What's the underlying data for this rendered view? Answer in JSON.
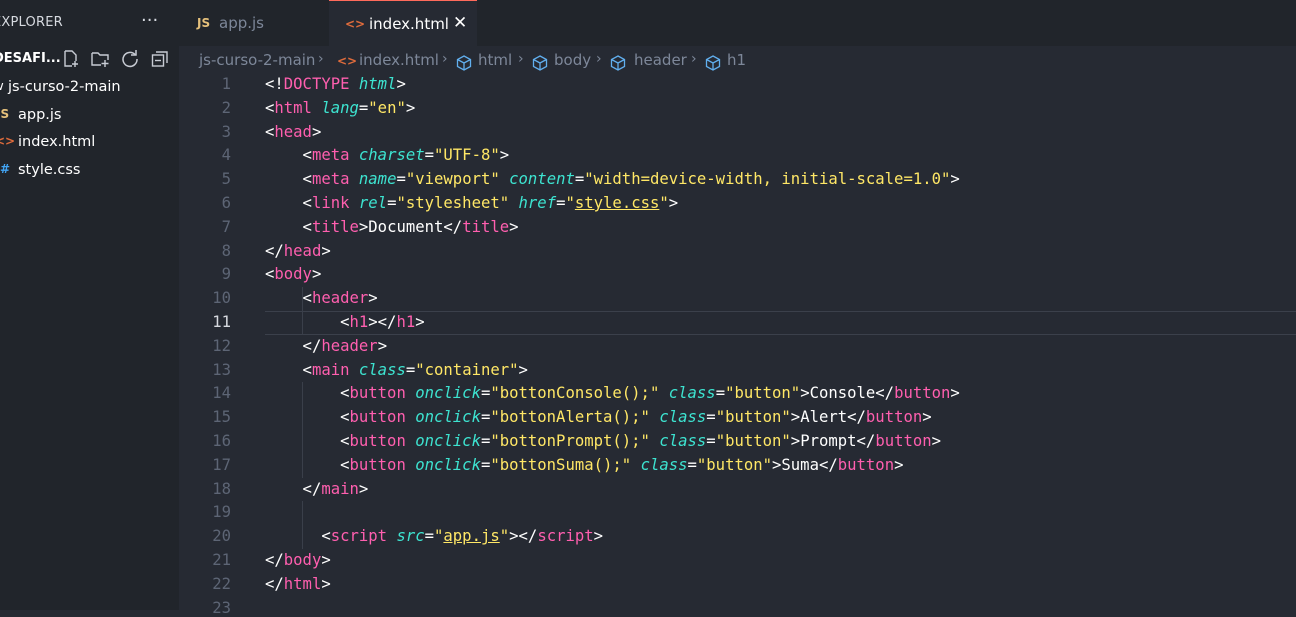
{
  "explorer": {
    "title": "EXPLORER",
    "more": "···",
    "project": "DESAFI...",
    "tree": [
      {
        "label": "js-curso-2-main",
        "icon": "chevron-down-icon",
        "glyph": "∨"
      },
      {
        "label": "app.js",
        "icon": "js-file-icon",
        "glyph": "JS"
      },
      {
        "label": "index.html",
        "icon": "html-file-icon",
        "glyph": "<>"
      },
      {
        "label": "style.css",
        "icon": "css-file-icon",
        "glyph": "#"
      }
    ]
  },
  "tabs": [
    {
      "label": "app.js",
      "icon": "JS",
      "active": false
    },
    {
      "label": "index.html",
      "icon": "<>",
      "active": true,
      "close": "✕"
    }
  ],
  "breadcrumb": [
    "js-curso-2-main",
    "index.html",
    "html",
    "body",
    "header",
    "h1"
  ],
  "editor": {
    "current_line": 11,
    "lines": [
      {
        "n": "1",
        "tokens": [
          [
            "p",
            "<!"
          ],
          [
            "t",
            "DOCTYPE"
          ],
          [
            "p",
            " "
          ],
          [
            "a",
            "html"
          ],
          [
            "p",
            ">"
          ]
        ]
      },
      {
        "n": "2",
        "tokens": [
          [
            "p",
            "<"
          ],
          [
            "t",
            "html"
          ],
          [
            "p",
            " "
          ],
          [
            "a",
            "lang"
          ],
          [
            "p",
            "="
          ],
          [
            "s",
            "\"en\""
          ],
          [
            "p",
            ">"
          ]
        ]
      },
      {
        "n": "3",
        "tokens": [
          [
            "p",
            "<"
          ],
          [
            "t",
            "head"
          ],
          [
            "p",
            ">"
          ]
        ]
      },
      {
        "n": "4",
        "tokens": [
          [
            "p",
            "    <"
          ],
          [
            "t",
            "meta"
          ],
          [
            "p",
            " "
          ],
          [
            "a",
            "charset"
          ],
          [
            "p",
            "="
          ],
          [
            "s",
            "\"UTF-8\""
          ],
          [
            "p",
            ">"
          ]
        ]
      },
      {
        "n": "5",
        "tokens": [
          [
            "p",
            "    <"
          ],
          [
            "t",
            "meta"
          ],
          [
            "p",
            " "
          ],
          [
            "a",
            "name"
          ],
          [
            "p",
            "="
          ],
          [
            "s",
            "\"viewport\""
          ],
          [
            "p",
            " "
          ],
          [
            "a",
            "content"
          ],
          [
            "p",
            "="
          ],
          [
            "s",
            "\"width=device-width, initial-scale=1.0\""
          ],
          [
            "p",
            ">"
          ]
        ]
      },
      {
        "n": "6",
        "tokens": [
          [
            "p",
            "    <"
          ],
          [
            "t",
            "link"
          ],
          [
            "p",
            " "
          ],
          [
            "a",
            "rel"
          ],
          [
            "p",
            "="
          ],
          [
            "s",
            "\"stylesheet\""
          ],
          [
            "p",
            " "
          ],
          [
            "a",
            "href"
          ],
          [
            "p",
            "="
          ],
          [
            "s",
            "\""
          ],
          [
            "l",
            "style.css"
          ],
          [
            "s",
            "\""
          ],
          [
            "p",
            ">"
          ]
        ]
      },
      {
        "n": "7",
        "tokens": [
          [
            "p",
            "    <"
          ],
          [
            "t",
            "title"
          ],
          [
            "p",
            ">"
          ],
          [
            "x",
            "Document"
          ],
          [
            "p",
            "</"
          ],
          [
            "t",
            "title"
          ],
          [
            "p",
            ">"
          ]
        ]
      },
      {
        "n": "8",
        "tokens": [
          [
            "p",
            "</"
          ],
          [
            "t",
            "head"
          ],
          [
            "p",
            ">"
          ]
        ]
      },
      {
        "n": "9",
        "tokens": [
          [
            "p",
            "<"
          ],
          [
            "t",
            "body"
          ],
          [
            "p",
            ">"
          ]
        ]
      },
      {
        "n": "10",
        "tokens": [
          [
            "p",
            "    <"
          ],
          [
            "t",
            "header"
          ],
          [
            "p",
            ">"
          ]
        ]
      },
      {
        "n": "11",
        "tokens": [
          [
            "p",
            "        <"
          ],
          [
            "t",
            "h1"
          ],
          [
            "p",
            "></"
          ],
          [
            "t",
            "h1"
          ],
          [
            "p",
            ">"
          ]
        ]
      },
      {
        "n": "12",
        "tokens": [
          [
            "p",
            "    </"
          ],
          [
            "t",
            "header"
          ],
          [
            "p",
            ">"
          ]
        ]
      },
      {
        "n": "13",
        "tokens": [
          [
            "p",
            "    <"
          ],
          [
            "t",
            "main"
          ],
          [
            "p",
            " "
          ],
          [
            "a",
            "class"
          ],
          [
            "p",
            "="
          ],
          [
            "s",
            "\"container\""
          ],
          [
            "p",
            ">"
          ]
        ]
      },
      {
        "n": "14",
        "tokens": [
          [
            "p",
            "        <"
          ],
          [
            "t",
            "button"
          ],
          [
            "p",
            " "
          ],
          [
            "a",
            "onclick"
          ],
          [
            "p",
            "="
          ],
          [
            "s",
            "\"bottonConsole();\""
          ],
          [
            "p",
            " "
          ],
          [
            "a",
            "class"
          ],
          [
            "p",
            "="
          ],
          [
            "s",
            "\"button\""
          ],
          [
            "p",
            ">"
          ],
          [
            "x",
            "Console"
          ],
          [
            "p",
            "</"
          ],
          [
            "t",
            "button"
          ],
          [
            "p",
            ">"
          ]
        ]
      },
      {
        "n": "15",
        "tokens": [
          [
            "p",
            "        <"
          ],
          [
            "t",
            "button"
          ],
          [
            "p",
            " "
          ],
          [
            "a",
            "onclick"
          ],
          [
            "p",
            "="
          ],
          [
            "s",
            "\"bottonAlerta();\""
          ],
          [
            "p",
            " "
          ],
          [
            "a",
            "class"
          ],
          [
            "p",
            "="
          ],
          [
            "s",
            "\"button\""
          ],
          [
            "p",
            ">"
          ],
          [
            "x",
            "Alert"
          ],
          [
            "p",
            "</"
          ],
          [
            "t",
            "button"
          ],
          [
            "p",
            ">"
          ]
        ]
      },
      {
        "n": "16",
        "tokens": [
          [
            "p",
            "        <"
          ],
          [
            "t",
            "button"
          ],
          [
            "p",
            " "
          ],
          [
            "a",
            "onclick"
          ],
          [
            "p",
            "="
          ],
          [
            "s",
            "\"bottonPrompt();\""
          ],
          [
            "p",
            " "
          ],
          [
            "a",
            "class"
          ],
          [
            "p",
            "="
          ],
          [
            "s",
            "\"button\""
          ],
          [
            "p",
            ">"
          ],
          [
            "x",
            "Prompt"
          ],
          [
            "p",
            "</"
          ],
          [
            "t",
            "button"
          ],
          [
            "p",
            ">"
          ]
        ]
      },
      {
        "n": "17",
        "tokens": [
          [
            "p",
            "        <"
          ],
          [
            "t",
            "button"
          ],
          [
            "p",
            " "
          ],
          [
            "a",
            "onclick"
          ],
          [
            "p",
            "="
          ],
          [
            "s",
            "\"bottonSuma();\""
          ],
          [
            "p",
            " "
          ],
          [
            "a",
            "class"
          ],
          [
            "p",
            "="
          ],
          [
            "s",
            "\"button\""
          ],
          [
            "p",
            ">"
          ],
          [
            "x",
            "Suma"
          ],
          [
            "p",
            "</"
          ],
          [
            "t",
            "button"
          ],
          [
            "p",
            ">"
          ]
        ]
      },
      {
        "n": "18",
        "tokens": [
          [
            "p",
            "    </"
          ],
          [
            "t",
            "main"
          ],
          [
            "p",
            ">"
          ]
        ]
      },
      {
        "n": "19",
        "tokens": []
      },
      {
        "n": "20",
        "tokens": [
          [
            "p",
            "      <"
          ],
          [
            "t",
            "script"
          ],
          [
            "p",
            " "
          ],
          [
            "a",
            "src"
          ],
          [
            "p",
            "="
          ],
          [
            "s",
            "\""
          ],
          [
            "l",
            "app.js"
          ],
          [
            "s",
            "\""
          ],
          [
            "p",
            "></"
          ],
          [
            "t",
            "script"
          ],
          [
            "p",
            ">"
          ]
        ]
      },
      {
        "n": "21",
        "tokens": [
          [
            "p",
            "</"
          ],
          [
            "t",
            "body"
          ],
          [
            "p",
            ">"
          ]
        ]
      },
      {
        "n": "22",
        "tokens": [
          [
            "p",
            "</"
          ],
          [
            "t",
            "html"
          ],
          [
            "p",
            ">"
          ]
        ]
      },
      {
        "n": "23",
        "tokens": []
      }
    ]
  },
  "colors": {
    "tag": "#ff5faf",
    "attr": "#3de3d0",
    "string": "#ffe766",
    "accent": "#ff6a5b"
  }
}
